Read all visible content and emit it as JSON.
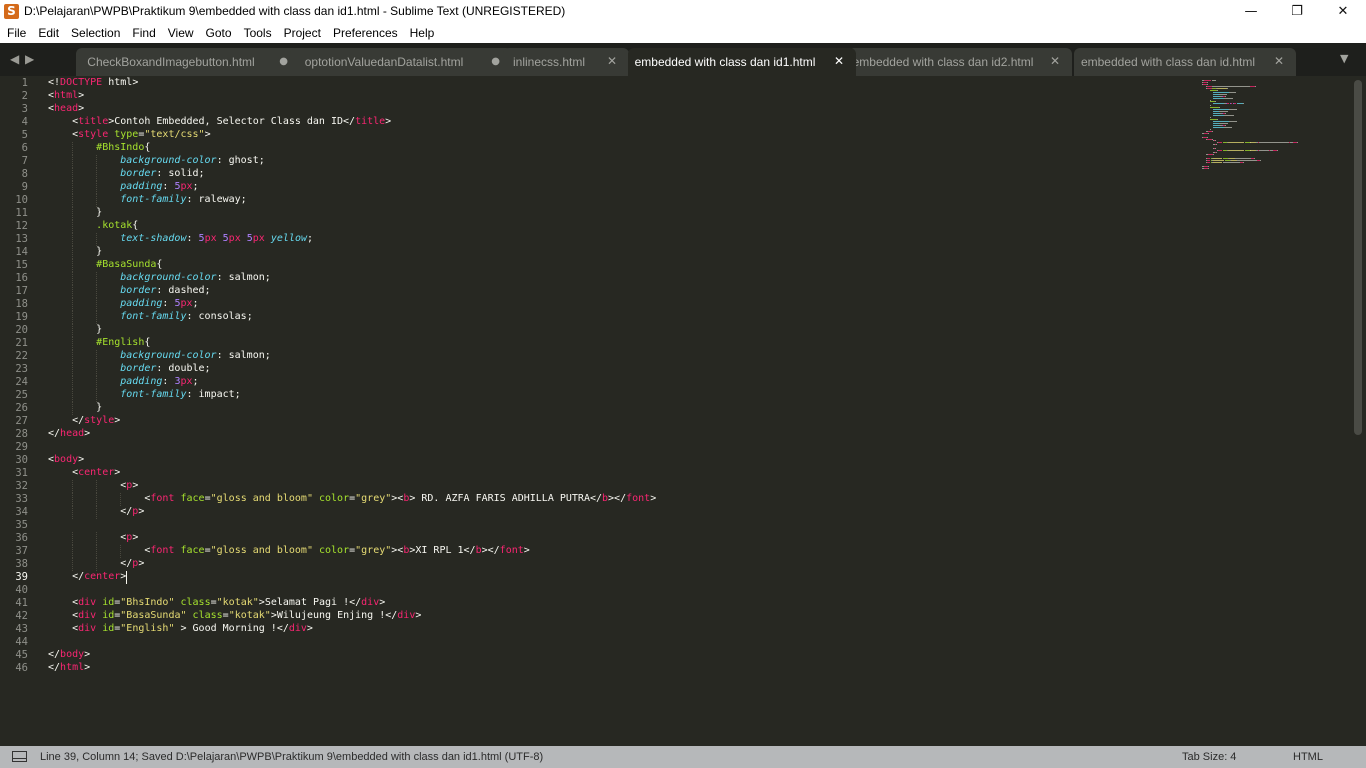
{
  "window": {
    "title": "D:\\Pelajaran\\PWPB\\Praktikum 9\\embedded with class dan id1.html - Sublime Text (UNREGISTERED)",
    "icon": "S",
    "minimize": "—",
    "maximize": "❐",
    "close": "✕"
  },
  "menu": [
    "File",
    "Edit",
    "Selection",
    "Find",
    "View",
    "Goto",
    "Tools",
    "Project",
    "Preferences",
    "Help"
  ],
  "tabs": [
    {
      "label": "CheckBoxandImagebutton.html",
      "status": "●",
      "active": false
    },
    {
      "label": "optotionValuedanDatalist.html",
      "status": "●",
      "active": false
    },
    {
      "label": "inlinecss.html",
      "status": "✕",
      "active": false
    },
    {
      "label": "embedded with class dan id1.html",
      "status": "✕",
      "active": true
    },
    {
      "label": "embedded with class dan id2.html",
      "status": "✕",
      "active": false
    },
    {
      "label": "embedded with class dan id.html",
      "status": "✕",
      "active": false
    }
  ],
  "nav": {
    "left": "◀",
    "right": "▶",
    "overflow": "▼"
  },
  "editor": {
    "current_line": 39,
    "lines": [
      [
        [
          "<!",
          "c-punc"
        ],
        [
          "DOCTYPE",
          "c-tag"
        ],
        [
          " html",
          "c-val"
        ],
        [
          ">",
          "c-punc"
        ]
      ],
      [
        [
          "<",
          "c-punc"
        ],
        [
          "html",
          "c-tag"
        ],
        [
          ">",
          "c-punc"
        ]
      ],
      [
        [
          "<",
          "c-punc"
        ],
        [
          "head",
          "c-tag"
        ],
        [
          ">",
          "c-punc"
        ]
      ],
      [
        [
          "    <",
          "c-punc"
        ],
        [
          "title",
          "c-tag"
        ],
        [
          ">Contoh Embedded, Selector Class dan ID</",
          "c-val"
        ],
        [
          "title",
          "c-tag"
        ],
        [
          ">",
          "c-punc"
        ]
      ],
      [
        [
          "    <",
          "c-punc"
        ],
        [
          "style",
          "c-tag"
        ],
        [
          " ",
          "c-val"
        ],
        [
          "type",
          "c-attr"
        ],
        [
          "=",
          "c-punc"
        ],
        [
          "\"text/css\"",
          "c-str"
        ],
        [
          ">",
          "c-punc"
        ]
      ],
      [
        [
          "        ",
          "c-val"
        ],
        [
          "#BhsIndo",
          "c-sel"
        ],
        [
          "{",
          "c-punc"
        ]
      ],
      [
        [
          "            ",
          "c-val"
        ],
        [
          "background-color",
          "c-prop"
        ],
        [
          ": ghost;",
          "c-val"
        ]
      ],
      [
        [
          "            ",
          "c-val"
        ],
        [
          "border",
          "c-prop"
        ],
        [
          ": solid;",
          "c-val"
        ]
      ],
      [
        [
          "            ",
          "c-val"
        ],
        [
          "padding",
          "c-prop"
        ],
        [
          ": ",
          "c-val"
        ],
        [
          "5",
          "c-num"
        ],
        [
          "px",
          "c-unit"
        ],
        [
          ";",
          "c-val"
        ]
      ],
      [
        [
          "            ",
          "c-val"
        ],
        [
          "font-family",
          "c-prop"
        ],
        [
          ": raleway;",
          "c-val"
        ]
      ],
      [
        [
          "        }",
          "c-punc"
        ]
      ],
      [
        [
          "        ",
          "c-val"
        ],
        [
          ".kotak",
          "c-sel"
        ],
        [
          "{",
          "c-punc"
        ]
      ],
      [
        [
          "            ",
          "c-val"
        ],
        [
          "text-shadow",
          "c-prop"
        ],
        [
          ": ",
          "c-val"
        ],
        [
          "5",
          "c-num"
        ],
        [
          "px",
          "c-unit"
        ],
        [
          " ",
          "c-val"
        ],
        [
          "5",
          "c-num"
        ],
        [
          "px",
          "c-unit"
        ],
        [
          " ",
          "c-val"
        ],
        [
          "5",
          "c-num"
        ],
        [
          "px",
          "c-unit"
        ],
        [
          " ",
          "c-val"
        ],
        [
          "yellow",
          "c-prop"
        ],
        [
          ";",
          "c-val"
        ]
      ],
      [
        [
          "        }",
          "c-punc"
        ]
      ],
      [
        [
          "        ",
          "c-val"
        ],
        [
          "#BasaSunda",
          "c-sel"
        ],
        [
          "{",
          "c-punc"
        ]
      ],
      [
        [
          "            ",
          "c-val"
        ],
        [
          "background-color",
          "c-prop"
        ],
        [
          ": salmon;",
          "c-val"
        ]
      ],
      [
        [
          "            ",
          "c-val"
        ],
        [
          "border",
          "c-prop"
        ],
        [
          ": dashed;",
          "c-val"
        ]
      ],
      [
        [
          "            ",
          "c-val"
        ],
        [
          "padding",
          "c-prop"
        ],
        [
          ": ",
          "c-val"
        ],
        [
          "5",
          "c-num"
        ],
        [
          "px",
          "c-unit"
        ],
        [
          ";",
          "c-val"
        ]
      ],
      [
        [
          "            ",
          "c-val"
        ],
        [
          "font-family",
          "c-prop"
        ],
        [
          ": consolas;",
          "c-val"
        ]
      ],
      [
        [
          "        }",
          "c-punc"
        ]
      ],
      [
        [
          "        ",
          "c-val"
        ],
        [
          "#English",
          "c-sel"
        ],
        [
          "{",
          "c-punc"
        ]
      ],
      [
        [
          "            ",
          "c-val"
        ],
        [
          "background-color",
          "c-prop"
        ],
        [
          ": salmon;",
          "c-val"
        ]
      ],
      [
        [
          "            ",
          "c-val"
        ],
        [
          "border",
          "c-prop"
        ],
        [
          ": double;",
          "c-val"
        ]
      ],
      [
        [
          "            ",
          "c-val"
        ],
        [
          "padding",
          "c-prop"
        ],
        [
          ": ",
          "c-val"
        ],
        [
          "3",
          "c-num"
        ],
        [
          "px",
          "c-unit"
        ],
        [
          ";",
          "c-val"
        ]
      ],
      [
        [
          "            ",
          "c-val"
        ],
        [
          "font-family",
          "c-prop"
        ],
        [
          ": impact;",
          "c-val"
        ]
      ],
      [
        [
          "        }",
          "c-punc"
        ]
      ],
      [
        [
          "    </",
          "c-punc"
        ],
        [
          "style",
          "c-tag"
        ],
        [
          ">",
          "c-punc"
        ]
      ],
      [
        [
          "</",
          "c-punc"
        ],
        [
          "head",
          "c-tag"
        ],
        [
          ">",
          "c-punc"
        ]
      ],
      [],
      [
        [
          "<",
          "c-punc"
        ],
        [
          "body",
          "c-tag"
        ],
        [
          ">",
          "c-punc"
        ]
      ],
      [
        [
          "    <",
          "c-punc"
        ],
        [
          "center",
          "c-tag"
        ],
        [
          ">",
          "c-punc"
        ]
      ],
      [
        [
          "            <",
          "c-punc"
        ],
        [
          "p",
          "c-tag"
        ],
        [
          ">",
          "c-punc"
        ]
      ],
      [
        [
          "                <",
          "c-punc"
        ],
        [
          "font",
          "c-tag"
        ],
        [
          " ",
          "c-val"
        ],
        [
          "face",
          "c-attr"
        ],
        [
          "=",
          "c-punc"
        ],
        [
          "\"gloss and bloom\"",
          "c-str"
        ],
        [
          " ",
          "c-val"
        ],
        [
          "color",
          "c-attr"
        ],
        [
          "=",
          "c-punc"
        ],
        [
          "\"grey\"",
          "c-str"
        ],
        [
          "><",
          "c-punc"
        ],
        [
          "b",
          "c-tag"
        ],
        [
          "> RD. AZFA FARIS ADHILLA PUTRA</",
          "c-val"
        ],
        [
          "b",
          "c-tag"
        ],
        [
          "></",
          "c-punc"
        ],
        [
          "font",
          "c-tag"
        ],
        [
          ">",
          "c-punc"
        ]
      ],
      [
        [
          "            </",
          "c-punc"
        ],
        [
          "p",
          "c-tag"
        ],
        [
          ">",
          "c-punc"
        ]
      ],
      [],
      [
        [
          "            <",
          "c-punc"
        ],
        [
          "p",
          "c-tag"
        ],
        [
          ">",
          "c-punc"
        ]
      ],
      [
        [
          "                <",
          "c-punc"
        ],
        [
          "font",
          "c-tag"
        ],
        [
          " ",
          "c-val"
        ],
        [
          "face",
          "c-attr"
        ],
        [
          "=",
          "c-punc"
        ],
        [
          "\"gloss and bloom\"",
          "c-str"
        ],
        [
          " ",
          "c-val"
        ],
        [
          "color",
          "c-attr"
        ],
        [
          "=",
          "c-punc"
        ],
        [
          "\"grey\"",
          "c-str"
        ],
        [
          "><",
          "c-punc"
        ],
        [
          "b",
          "c-tag"
        ],
        [
          ">XI RPL 1</",
          "c-val"
        ],
        [
          "b",
          "c-tag"
        ],
        [
          "></",
          "c-punc"
        ],
        [
          "font",
          "c-tag"
        ],
        [
          ">",
          "c-punc"
        ]
      ],
      [
        [
          "            </",
          "c-punc"
        ],
        [
          "p",
          "c-tag"
        ],
        [
          ">",
          "c-punc"
        ]
      ],
      [
        [
          "    </",
          "c-punc"
        ],
        [
          "center",
          "c-tag"
        ],
        [
          ">",
          "c-punc"
        ]
      ],
      [],
      [
        [
          "    <",
          "c-punc"
        ],
        [
          "div",
          "c-tag"
        ],
        [
          " ",
          "c-val"
        ],
        [
          "id",
          "c-attr"
        ],
        [
          "=",
          "c-punc"
        ],
        [
          "\"BhsIndo\"",
          "c-str"
        ],
        [
          " ",
          "c-val"
        ],
        [
          "class",
          "c-attr"
        ],
        [
          "=",
          "c-punc"
        ],
        [
          "\"kotak\"",
          "c-str"
        ],
        [
          ">Selamat Pagi !</",
          "c-val"
        ],
        [
          "div",
          "c-tag"
        ],
        [
          ">",
          "c-punc"
        ]
      ],
      [
        [
          "    <",
          "c-punc"
        ],
        [
          "div",
          "c-tag"
        ],
        [
          " ",
          "c-val"
        ],
        [
          "id",
          "c-attr"
        ],
        [
          "=",
          "c-punc"
        ],
        [
          "\"BasaSunda\"",
          "c-str"
        ],
        [
          " ",
          "c-val"
        ],
        [
          "class",
          "c-attr"
        ],
        [
          "=",
          "c-punc"
        ],
        [
          "\"kotak\"",
          "c-str"
        ],
        [
          ">Wilujeung Enjing !</",
          "c-val"
        ],
        [
          "div",
          "c-tag"
        ],
        [
          ">",
          "c-punc"
        ]
      ],
      [
        [
          "    <",
          "c-punc"
        ],
        [
          "div",
          "c-tag"
        ],
        [
          " ",
          "c-val"
        ],
        [
          "id",
          "c-attr"
        ],
        [
          "=",
          "c-punc"
        ],
        [
          "\"English\"",
          "c-str"
        ],
        [
          " > Good Morning !</",
          "c-val"
        ],
        [
          "div",
          "c-tag"
        ],
        [
          ">",
          "c-punc"
        ]
      ],
      [],
      [
        [
          "</",
          "c-punc"
        ],
        [
          "body",
          "c-tag"
        ],
        [
          ">",
          "c-punc"
        ]
      ],
      [
        [
          "</",
          "c-punc"
        ],
        [
          "html",
          "c-tag"
        ],
        [
          ">",
          "c-punc"
        ]
      ]
    ]
  },
  "status": {
    "text": "Line 39, Column 14; Saved D:\\Pelajaran\\PWPB\\Praktikum 9\\embedded with class dan id1.html (UTF-8)",
    "tab_size": "Tab Size: 4",
    "syntax": "HTML"
  },
  "colors": {
    "background": "#272822",
    "tag": "#f92672",
    "attribute": "#a6e22e",
    "string": "#e6db74",
    "property": "#66d9ef",
    "number": "#ae81ff"
  }
}
